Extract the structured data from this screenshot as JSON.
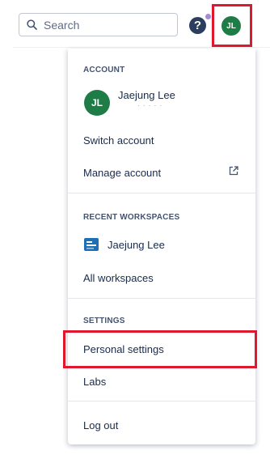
{
  "topbar": {
    "search_placeholder": "Search",
    "help_symbol": "?",
    "user_initials": "JL"
  },
  "menu": {
    "account": {
      "header": "ACCOUNT",
      "avatar_initials": "JL",
      "name": "Jaejung Lee",
      "email_partial": "· · · · ·"
    },
    "switch_account": "Switch account",
    "manage_account": "Manage account",
    "recent": {
      "header": "RECENT WORKSPACES",
      "workspace_name": "Jaejung Lee"
    },
    "all_workspaces": "All workspaces",
    "settings": {
      "header": "SETTINGS",
      "personal_settings": "Personal settings",
      "labs": "Labs"
    },
    "log_out": "Log out"
  },
  "colors": {
    "avatar": "#1e7d46",
    "highlight": "#e0182d",
    "help_bg": "#2c3e5d",
    "notification_dot": "#a78bd9"
  },
  "icons": [
    "search-icon",
    "help-icon",
    "external-link-icon",
    "workspace-board-icon"
  ]
}
